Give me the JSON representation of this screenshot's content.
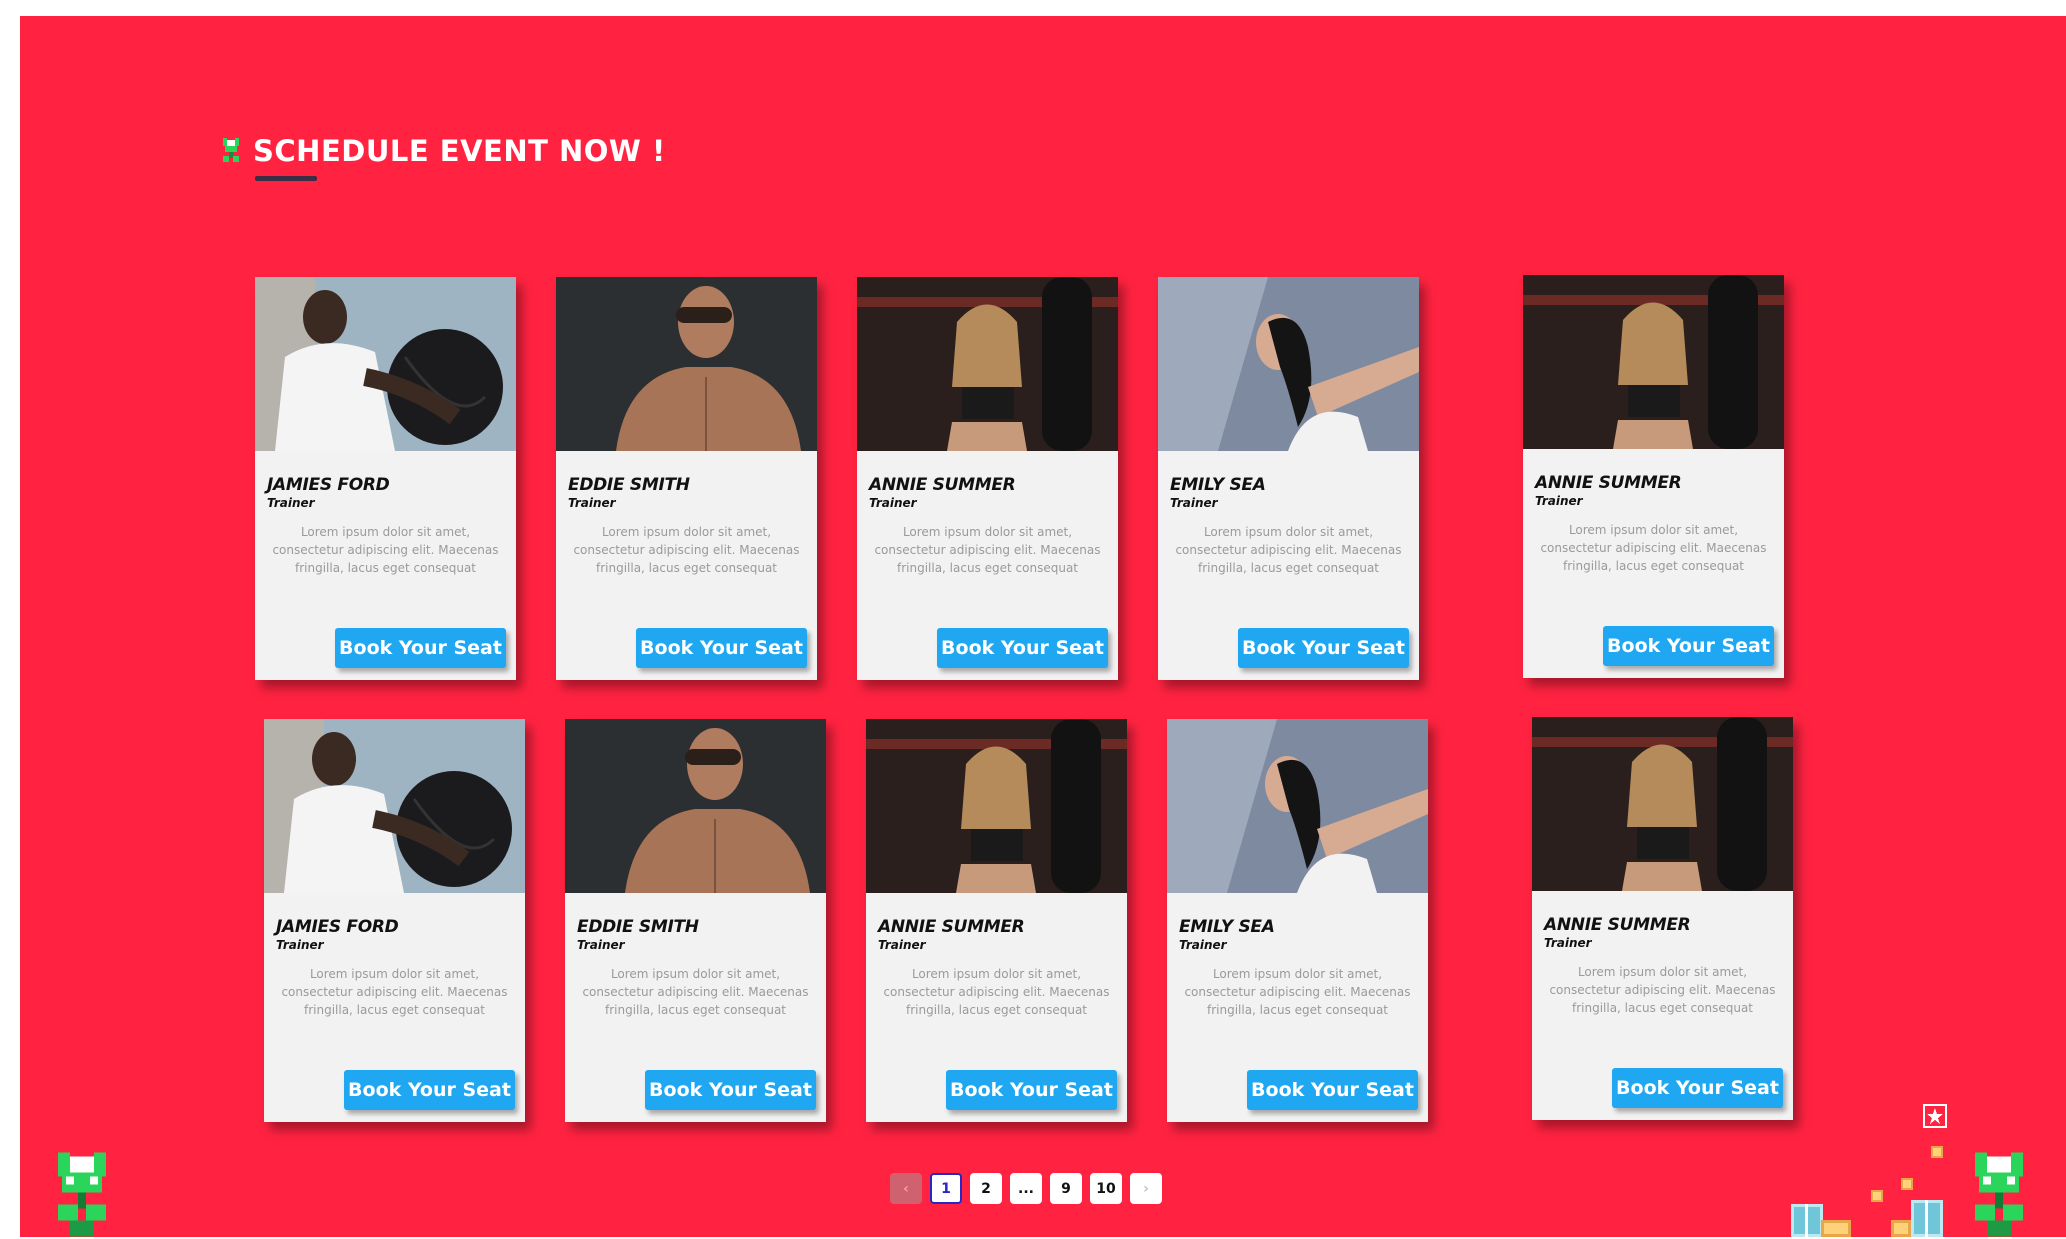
{
  "section": {
    "title": "SCHEDULE EVENT NOW !",
    "accent_color": "#ff2341",
    "title_icon": "piranha-plant-icon"
  },
  "cards": [
    {
      "name": "JAMIES FORD",
      "role": "Trainer",
      "description": "Lorem ipsum dolor sit amet, consectetur adipiscing elit. Maecenas fringilla, lacus eget consequat",
      "button": "Book Your Seat",
      "photo": "man-with-medicine-ball"
    },
    {
      "name": "EDDIE SMITH",
      "role": "Trainer",
      "description": "Lorem ipsum dolor sit amet, consectetur adipiscing elit. Maecenas fringilla, lacus eget consequat",
      "button": "Book Your Seat",
      "photo": "shirtless-man"
    },
    {
      "name": "ANNIE SUMMER",
      "role": "Trainer",
      "description": "Lorem ipsum dolor sit amet, consectetur adipiscing elit. Maecenas fringilla, lacus eget consequat",
      "button": "Book Your Seat",
      "photo": "woman-in-gym"
    },
    {
      "name": "EMILY SEA",
      "role": "Trainer",
      "description": "Lorem ipsum dolor sit amet, consectetur adipiscing elit. Maecenas fringilla, lacus eget consequat",
      "button": "Book Your Seat",
      "photo": "woman-stretching"
    },
    {
      "name": "ANNIE SUMMER",
      "role": "Trainer",
      "description": "Lorem ipsum dolor sit amet, consectetur adipiscing elit. Maecenas fringilla, lacus eget consequat",
      "button": "Book Your Seat",
      "photo": "woman-in-gym"
    },
    {
      "name": "JAMIES FORD",
      "role": "Trainer",
      "description": "Lorem ipsum dolor sit amet, consectetur adipiscing elit. Maecenas fringilla, lacus eget consequat",
      "button": "Book Your Seat",
      "photo": "man-with-medicine-ball"
    },
    {
      "name": "EDDIE SMITH",
      "role": "Trainer",
      "description": "Lorem ipsum dolor sit amet, consectetur adipiscing elit. Maecenas fringilla, lacus eget consequat",
      "button": "Book Your Seat",
      "photo": "shirtless-man"
    },
    {
      "name": "ANNIE SUMMER",
      "role": "Trainer",
      "description": "Lorem ipsum dolor sit amet, consectetur adipiscing elit. Maecenas fringilla, lacus eget consequat",
      "button": "Book Your Seat",
      "photo": "woman-in-gym"
    },
    {
      "name": "EMILY SEA",
      "role": "Trainer",
      "description": "Lorem ipsum dolor sit amet, consectetur adipiscing elit. Maecenas fringilla, lacus eget consequat",
      "button": "Book Your Seat",
      "photo": "woman-stretching"
    },
    {
      "name": "ANNIE SUMMER",
      "role": "Trainer",
      "description": "Lorem ipsum dolor sit amet, consectetur adipiscing elit. Maecenas fringilla, lacus eget consequat",
      "button": "Book Your Seat",
      "photo": "woman-in-gym"
    }
  ],
  "pagination": {
    "prev_icon": "chevron-left-icon",
    "next_icon": "chevron-right-icon",
    "pages": [
      "1",
      "2",
      "...",
      "9",
      "10"
    ],
    "current": "1",
    "prev_glyph": "‹",
    "next_glyph": "›",
    "active_color": "#2626c9"
  },
  "decorations": [
    "piranha-plant-icon",
    "piranha-plant-icon",
    "pixel-blocks-icon",
    "star-box-icon"
  ]
}
